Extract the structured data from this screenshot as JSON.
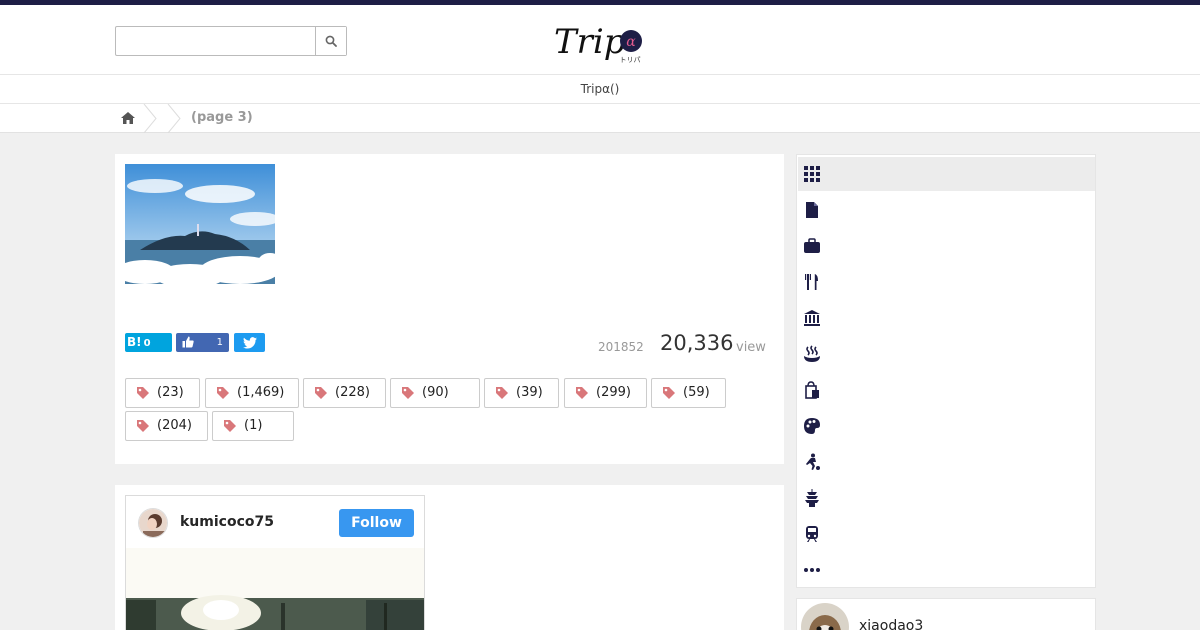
{
  "header": {
    "search": {
      "value": "",
      "placeholder": "",
      "button_icon": "search-icon"
    },
    "logo": {
      "text": "Trip",
      "alpha": "α",
      "kana": "トリパ"
    }
  },
  "subnav": {
    "label": "Tripα()"
  },
  "breadcrumb": {
    "home_icon": "home-icon",
    "current": "(page 3)"
  },
  "article": {
    "share": {
      "hatena_label": "B!",
      "hatena_count": "0",
      "like_count": "1"
    },
    "date": "201852",
    "views": "20,336",
    "views_unit": "view",
    "tags": [
      {
        "label": "(23)"
      },
      {
        "label": "(1,469)"
      },
      {
        "label": "(228)"
      },
      {
        "label": "(90)"
      },
      {
        "label": "(39)"
      },
      {
        "label": "(299)"
      },
      {
        "label": "(59)"
      },
      {
        "label": "(204)"
      },
      {
        "label": "(1)"
      }
    ]
  },
  "embed": {
    "username": "kumicoco75",
    "follow_label": "Follow"
  },
  "sidebar": {
    "categories": [
      {
        "icon": "grid-icon",
        "active": true
      },
      {
        "icon": "document-icon"
      },
      {
        "icon": "suitcase-icon"
      },
      {
        "icon": "restaurant-icon"
      },
      {
        "icon": "museum-icon"
      },
      {
        "icon": "hot-spring-icon"
      },
      {
        "icon": "shopping-icon"
      },
      {
        "icon": "art-palette-icon"
      },
      {
        "icon": "sports-icon"
      },
      {
        "icon": "pagoda-icon"
      },
      {
        "icon": "train-icon"
      },
      {
        "icon": "more-icon"
      }
    ]
  },
  "user_card": {
    "name": "xiaodao3"
  },
  "colors": {
    "accent": "#1e1e46",
    "tag_icon": "#d9777a",
    "hatena": "#00a4de",
    "facebook": "#4267b2",
    "twitter": "#1d9bf0",
    "follow": "#3897f0"
  }
}
